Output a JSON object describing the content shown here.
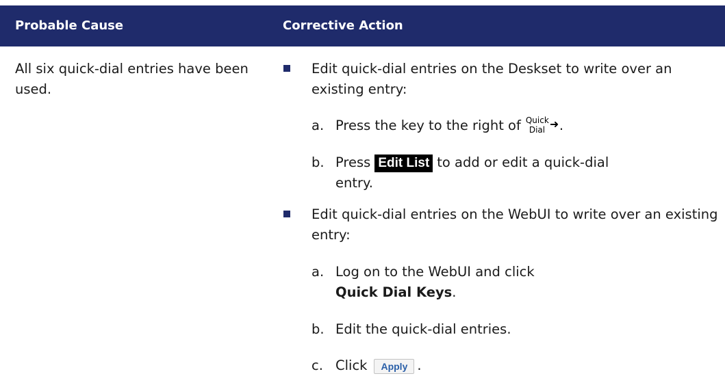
{
  "table": {
    "headers": {
      "cause": "Probable Cause",
      "action": "Corrective Action"
    },
    "colors": {
      "header_bg": "#1f2b6b",
      "header_text": "#ffffff",
      "bullet": "#1f2b6b",
      "apply_text": "#2a5fa8"
    },
    "row": {
      "cause": "All six quick-dial entries have been used.",
      "bullets": [
        {
          "text": "Edit quick-dial entries on the Deskset to write over an existing entry:",
          "steps": [
            {
              "letter": "a.",
              "text": "Press the key to the right of",
              "icon": {
                "name": "quick-dial-arrow-icon",
                "line1": "Quick",
                "line2": "Dial",
                "arrow": "➜",
                "suffix": "."
              }
            },
            {
              "letter": "b.",
              "pre": "Press",
              "softkey": "Edit List",
              "post": "to add or edit a quick-dial",
              "cont": "entry."
            }
          ]
        },
        {
          "text": "Edit quick-dial entries on the WebUI to write over an existing entry:",
          "steps": [
            {
              "letter": "a.",
              "text": "Log on to the WebUI and click",
              "bold": "Quick Dial Keys",
              "suffix": "."
            },
            {
              "letter": "b.",
              "text": "Edit the quick-dial entries."
            },
            {
              "letter": "c.",
              "pre": "Click",
              "button": "Apply",
              "suffix": "."
            }
          ]
        }
      ]
    }
  }
}
